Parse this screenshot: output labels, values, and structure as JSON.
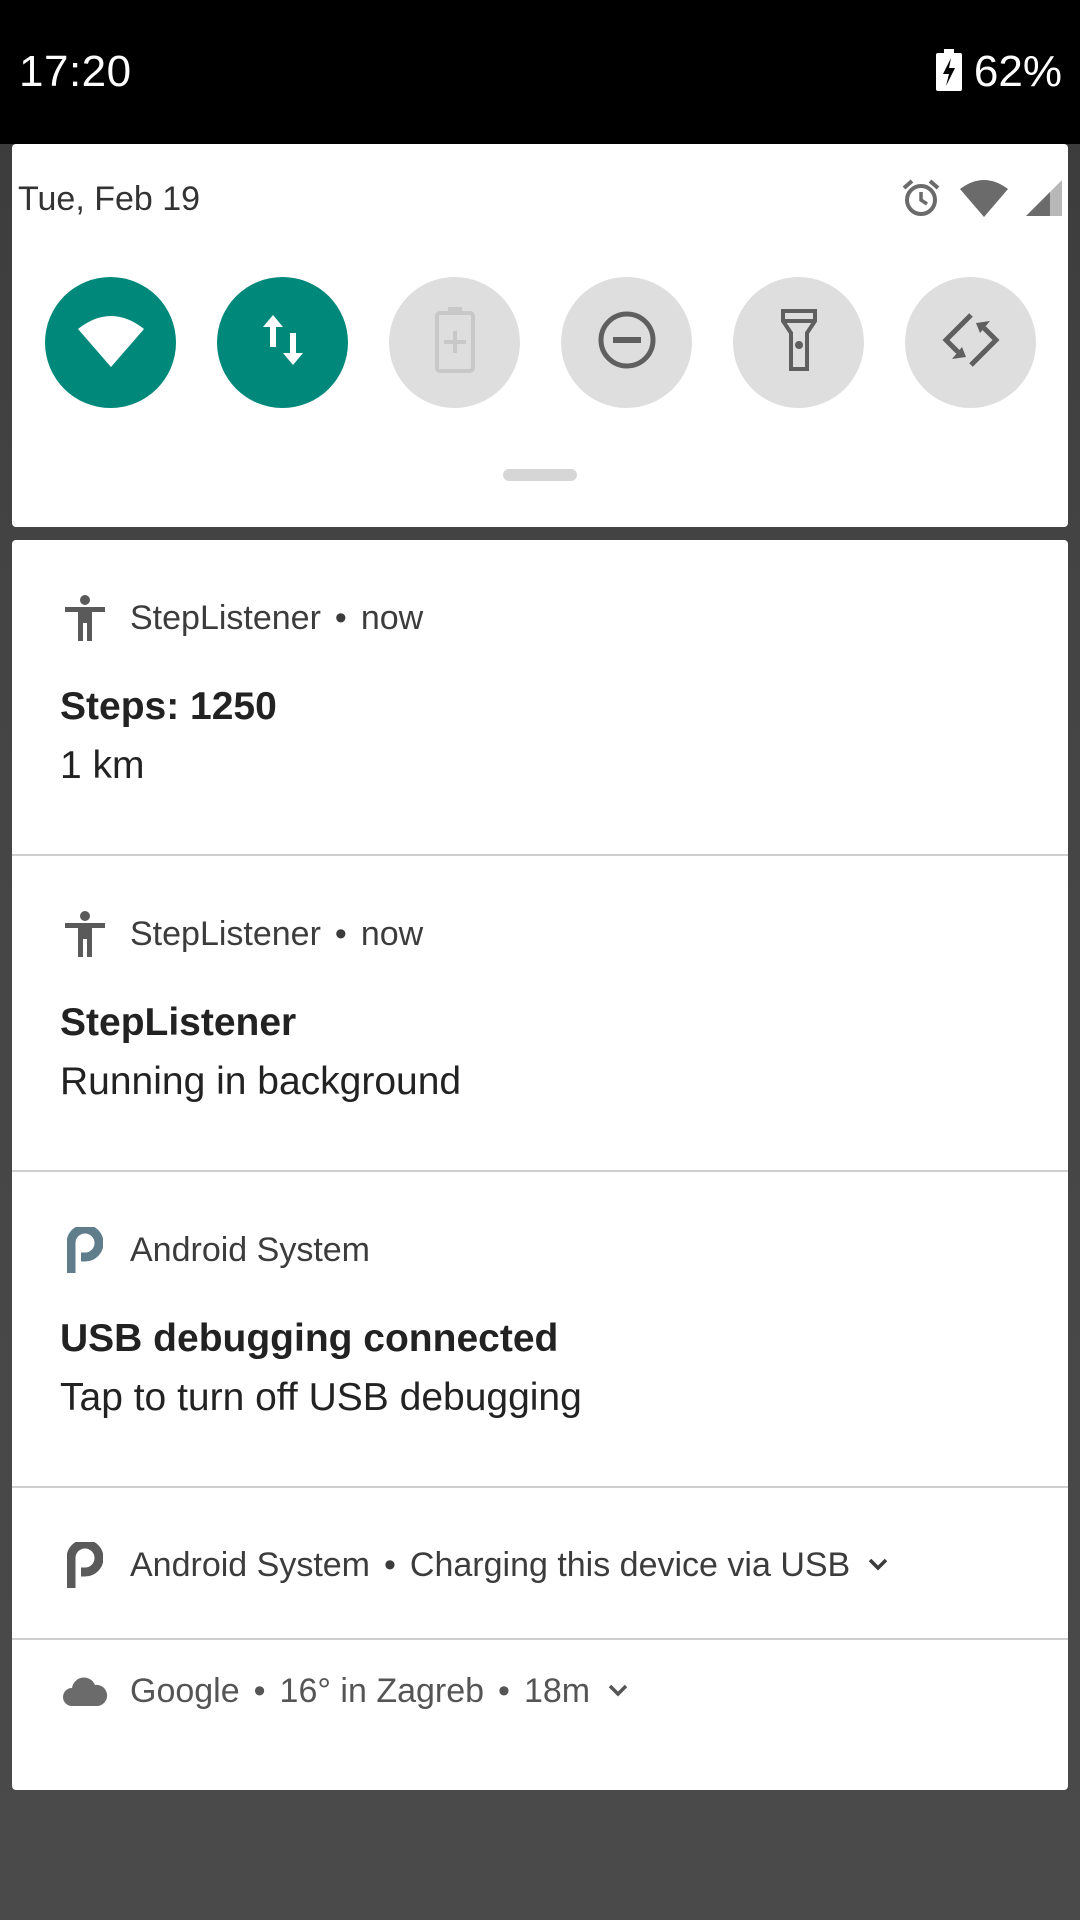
{
  "status_bar": {
    "time": "17:20",
    "battery_percent": "62%",
    "battery_icon": "battery-charging-icon"
  },
  "quick_settings": {
    "date": "Tue, Feb 19",
    "status_icons": [
      "alarm-icon",
      "wifi-icon",
      "cellular-signal-icon"
    ],
    "tiles": [
      {
        "name": "wifi",
        "icon": "wifi-icon",
        "active": true
      },
      {
        "name": "mobile-data",
        "icon": "data-arrows-icon",
        "active": true
      },
      {
        "name": "battery-saver",
        "icon": "battery-saver-icon",
        "active": false
      },
      {
        "name": "do-not-disturb",
        "icon": "do-not-disturb-icon",
        "active": false
      },
      {
        "name": "flashlight",
        "icon": "flashlight-icon",
        "active": false
      },
      {
        "name": "auto-rotate",
        "icon": "auto-rotate-icon",
        "active": false
      }
    ],
    "accent_color": "#00897b"
  },
  "notifications": [
    {
      "app": "StepListener",
      "time": "now",
      "icon": "accessibility-person-icon",
      "title": "Steps: 1250",
      "text": "1 km"
    },
    {
      "app": "StepListener",
      "time": "now",
      "icon": "accessibility-person-icon",
      "title": "StepListener",
      "text": "Running in background"
    },
    {
      "app": "Android System",
      "icon": "android-p-icon",
      "title": "USB debugging connected",
      "text": "Tap to turn off USB debugging"
    },
    {
      "app": "Android System",
      "icon": "android-p-icon",
      "summary": "Charging this device via USB"
    },
    {
      "app": "Google",
      "icon": "cloud-icon",
      "summary": "16° in Zagreb",
      "time": "18m"
    }
  ]
}
